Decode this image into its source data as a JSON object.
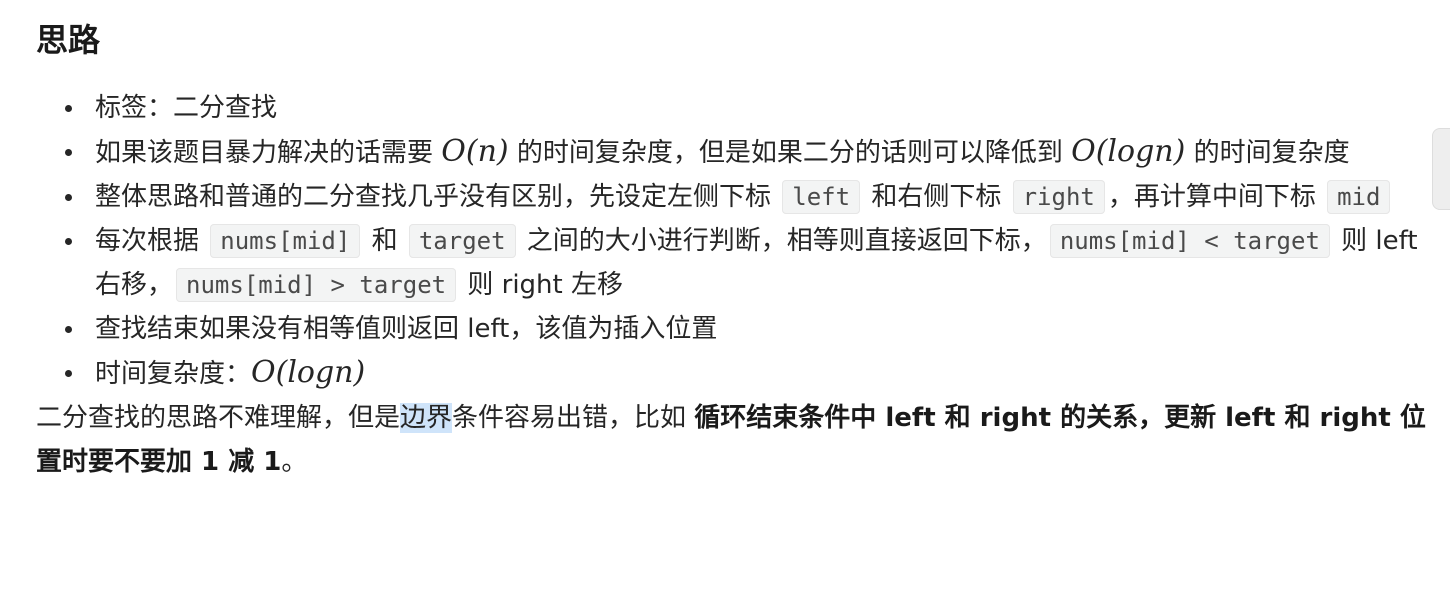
{
  "heading": "思路",
  "items": {
    "i1": {
      "text": "标签：二分查找"
    },
    "i2": {
      "t1": "如果该题目暴力解决的话需要 ",
      "m1": "O(n)",
      "t2": " 的时间复杂度，但是如果二分的话则可以降低到 ",
      "m2": "O(logn)",
      "t3": " 的时间复杂度"
    },
    "i3": {
      "t1": "整体思路和普通的二分查找几乎没有区别，先设定左侧下标 ",
      "c1": "left",
      "t2": " 和右侧下标 ",
      "c2": "right",
      "t3": "，再计算中间下标 ",
      "c3": "mid"
    },
    "i4": {
      "t1": "每次根据 ",
      "c1": "nums[mid]",
      "t2": " 和 ",
      "c2": "target",
      "t3": " 之间的大小进行判断，相等则直接返回下标，",
      "c3": "nums[mid] < target",
      "t4": " 则 left 右移，",
      "c4": "nums[mid] > target",
      "t5": " 则 right 左移"
    },
    "i5": {
      "text": "查找结束如果没有相等值则返回 left，该值为插入位置"
    },
    "i6": {
      "t1": "时间复杂度：",
      "m1": "O(logn)"
    }
  },
  "para": {
    "t1": "二分查找的思路不难理解，但是",
    "hl": "边界",
    "t2": "条件容易出错，比如 ",
    "bold": "循环结束条件中 left 和 right 的关系，更新 left 和 right 位置时要不要加 1 减 1",
    "t3": "。"
  }
}
